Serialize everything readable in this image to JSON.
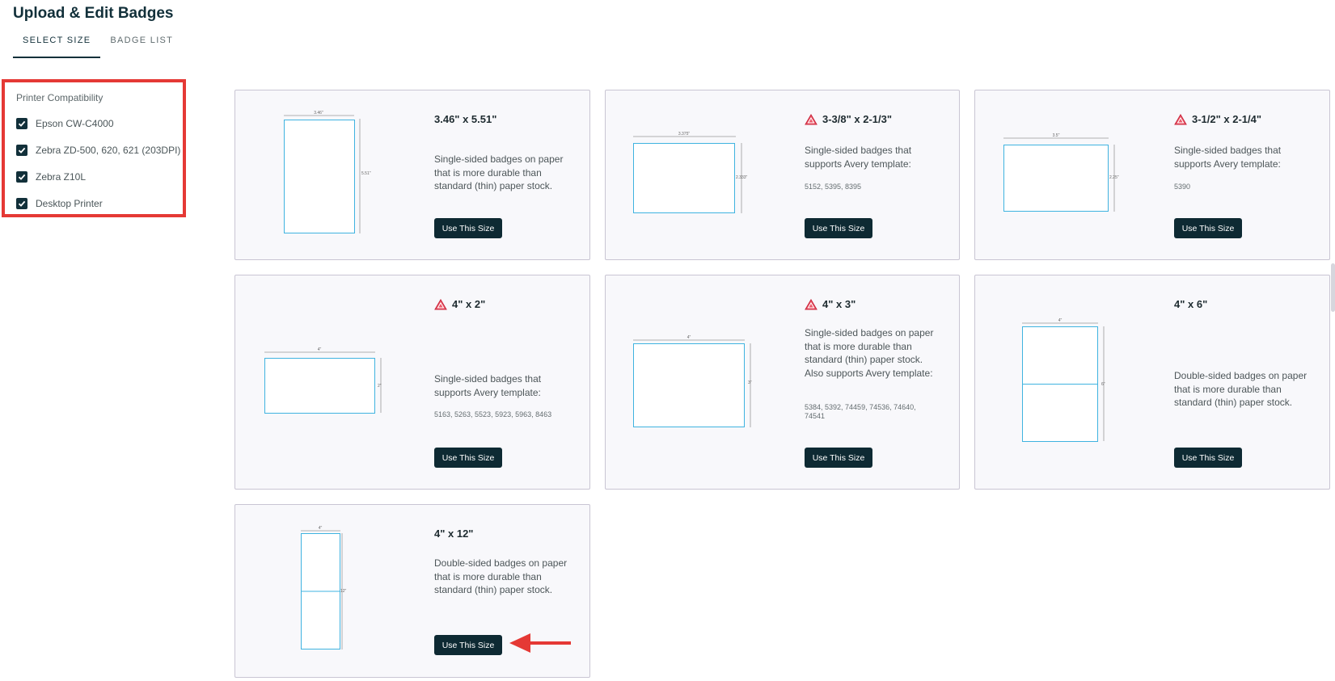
{
  "page": {
    "title": "Upload & Edit Badges"
  },
  "tabs": [
    {
      "label": "SELECT SIZE",
      "active": true
    },
    {
      "label": "BADGE LIST",
      "active": false
    }
  ],
  "filter": {
    "title": "Printer Compatibility",
    "options": [
      {
        "label": "Epson CW-C4000",
        "checked": true
      },
      {
        "label": "Zebra ZD-500, 620, 621 (203DPI)",
        "checked": true
      },
      {
        "label": "Zebra Z10L",
        "checked": true
      },
      {
        "label": "Desktop Printer",
        "checked": true
      }
    ]
  },
  "cards": [
    {
      "title": "3.46\" x 5.51\"",
      "warning": false,
      "description": "Single-sided badges on paper that is more durable than standard (thin) paper stock.",
      "templates": "",
      "button": "Use This Size",
      "diagram": {
        "width_label": "3.46\"",
        "height_label": "5.51\""
      }
    },
    {
      "title": "3-3/8\" x 2-1/3\"",
      "warning": true,
      "description": "Single-sided badges that supports Avery template:",
      "templates": "5152, 5395, 8395",
      "button": "Use This Size",
      "diagram": {
        "width_label": "3.375\"",
        "height_label": "2.333\""
      }
    },
    {
      "title": "3-1/2\" x 2-1/4\"",
      "warning": true,
      "description": "Single-sided badges that supports Avery template:",
      "templates": "5390",
      "button": "Use This Size",
      "diagram": {
        "width_label": "3.5\"",
        "height_label": "2.25\""
      }
    },
    {
      "title": "4\" x 2\"",
      "warning": true,
      "description": "Single-sided badges that supports Avery template:",
      "templates": "5163, 5263, 5523, 5923, 5963, 8463",
      "button": "Use This Size",
      "diagram": {
        "width_label": "4\"",
        "height_label": "2\""
      }
    },
    {
      "title": "4\" x 3\"",
      "warning": true,
      "description": "Single-sided badges on paper that is more durable than standard (thin) paper stock. Also supports Avery template:",
      "templates": "5384, 5392, 74459, 74536, 74640, 74541",
      "button": "Use This Size",
      "diagram": {
        "width_label": "4\"",
        "height_label": "3\""
      }
    },
    {
      "title": "4\" x 6\"",
      "warning": false,
      "description": "Double-sided badges on paper that is more durable than standard (thin) paper stock.",
      "templates": "",
      "button": "Use This Size",
      "diagram": {
        "width_label": "4\"",
        "height_label": "6\""
      }
    },
    {
      "title": "4\" x 12\"",
      "warning": false,
      "description": "Double-sided badges on paper that is more durable than standard (thin) paper stock.",
      "templates": "",
      "button": "Use This Size",
      "diagram": {
        "width_label": "4\"",
        "height_label": "12\""
      }
    }
  ],
  "colors": {
    "accent": "#12303a",
    "button_bg": "#0e2a33",
    "highlight": "#e53935",
    "badge_outline": "#3fb3e0",
    "warning": "#e53950"
  }
}
